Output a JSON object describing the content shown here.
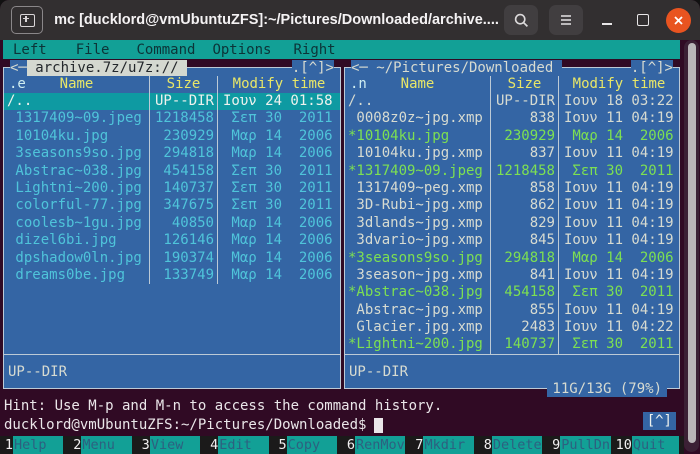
{
  "window": {
    "title": "mc [ducklord@vmUbuntuZFS]:~/Pictures/Downloaded/archive....",
    "controls": [
      "new-tab-icon",
      "search-icon",
      "hamburger-menu-icon",
      "minimize-icon",
      "maximize-icon",
      "close-icon"
    ],
    "close_color": "#e95420"
  },
  "menu": {
    "items": [
      {
        "label": "Left"
      },
      {
        "label": "File"
      },
      {
        "label": "Command"
      },
      {
        "label": "Options"
      },
      {
        "label": "Right"
      }
    ]
  },
  "left_panel": {
    "title_prefix": "<─",
    "title": " archive.7z/u7z:// ",
    "title_suffix": ".[^]>",
    "sort": ".e",
    "columns": {
      "name": "Name",
      "size": "Size",
      "modify": "Modify time"
    },
    "rows": [
      {
        "name": "/..",
        "size": "UP--DIR",
        "date": "Ιουν 24 01:58",
        "state": "selected"
      },
      {
        "name": " 1317409~09.jpeg",
        "size": "1218458",
        "date": " Σεπ 30  2011",
        "state": "regular"
      },
      {
        "name": " 10104ku.jpg",
        "size": "230929",
        "date": " Μαρ 14  2006",
        "state": "regular"
      },
      {
        "name": " 3seasons9so.jpg",
        "size": "294818",
        "date": " Μαρ 14  2006",
        "state": "regular"
      },
      {
        "name": " Abstrac~038.jpg",
        "size": "454158",
        "date": " Σεπ 30  2011",
        "state": "regular"
      },
      {
        "name": " Lightni~200.jpg",
        "size": "140737",
        "date": " Σεπ 30  2011",
        "state": "regular"
      },
      {
        "name": " colorful-77.jpg",
        "size": "347675",
        "date": " Σεπ 30  2011",
        "state": "regular"
      },
      {
        "name": " coolesb~1gu.jpg",
        "size": "40850",
        "date": " Μαρ 14  2006",
        "state": "regular"
      },
      {
        "name": " dizel6bi.jpg",
        "size": "126146",
        "date": " Μαρ 14  2006",
        "state": "regular"
      },
      {
        "name": " dpshadow0ln.jpg",
        "size": "190374",
        "date": " Μαρ 14  2006",
        "state": "regular"
      },
      {
        "name": " dreams0be.jpg",
        "size": "133749",
        "date": " Μαρ 14  2006",
        "state": "regular"
      }
    ],
    "status": "UP--DIR"
  },
  "right_panel": {
    "title_prefix": "<─",
    "title": " ~/Pictures/Downloaded ",
    "title_suffix": ".[^]>",
    "sort": ".n",
    "columns": {
      "name": "Name",
      "size": "Size",
      "modify": "Modify time"
    },
    "rows": [
      {
        "name": "/..",
        "size": "UP--DIR",
        "date": "Ιουν 18 03:22",
        "state": "plain"
      },
      {
        "name": " 0008z0z~jpg.xmp",
        "size": "838",
        "date": "Ιουν 11 04:19",
        "state": "plain"
      },
      {
        "name": "*10104ku.jpg",
        "size": "230929",
        "date": " Μαρ 14  2006",
        "state": "tagged"
      },
      {
        "name": " 10104ku.jpg.xmp",
        "size": "837",
        "date": "Ιουν 11 04:19",
        "state": "plain"
      },
      {
        "name": "*1317409~09.jpeg",
        "size": "1218458",
        "date": " Σεπ 30  2011",
        "state": "tagged"
      },
      {
        "name": " 1317409~peg.xmp",
        "size": "858",
        "date": "Ιουν 11 04:19",
        "state": "plain"
      },
      {
        "name": " 3D-Rubi~jpg.xmp",
        "size": "862",
        "date": "Ιουν 11 04:19",
        "state": "plain"
      },
      {
        "name": " 3dlands~jpg.xmp",
        "size": "829",
        "date": "Ιουν 11 04:19",
        "state": "plain"
      },
      {
        "name": " 3dvario~jpg.xmp",
        "size": "845",
        "date": "Ιουν 11 04:19",
        "state": "plain"
      },
      {
        "name": "*3seasons9so.jpg",
        "size": "294818",
        "date": " Μαρ 14  2006",
        "state": "tagged"
      },
      {
        "name": " 3season~jpg.xmp",
        "size": "841",
        "date": "Ιουν 11 04:19",
        "state": "plain"
      },
      {
        "name": "*Abstrac~038.jpg",
        "size": "454158",
        "date": " Σεπ 30  2011",
        "state": "tagged"
      },
      {
        "name": " Abstrac~jpg.xmp",
        "size": "855",
        "date": "Ιουν 11 04:19",
        "state": "plain"
      },
      {
        "name": " Glacier.jpg.xmp",
        "size": "2483",
        "date": "Ιουν 11 04:22",
        "state": "plain"
      },
      {
        "name": "*Lightni~200.jpg",
        "size": "140737",
        "date": " Σεπ 30  2011",
        "state": "tagged"
      }
    ],
    "status": "UP--DIR",
    "free_space": "11G/13G (79%)"
  },
  "hint": "Hint: Use M-p and M-n to access the command history.",
  "prompt": "ducklord@vmUbuntuZFS:~/Pictures/Downloaded$",
  "history_button": "[^]",
  "fnbar": {
    "items": [
      {
        "num": "1",
        "label": "Help"
      },
      {
        "num": "2",
        "label": "Menu"
      },
      {
        "num": "3",
        "label": "View"
      },
      {
        "num": "4",
        "label": "Edit"
      },
      {
        "num": "5",
        "label": "Copy"
      },
      {
        "num": "6",
        "label": "RenMov"
      },
      {
        "num": "7",
        "label": "Mkdir"
      },
      {
        "num": "8",
        "label": "Delete"
      },
      {
        "num": "9",
        "label": "PullDn"
      },
      {
        "num": "10",
        "label": "Quit"
      }
    ]
  },
  "colors": {
    "panel_bg": "#3465a4",
    "teal": "#12a096",
    "selected_bg": "#0e9aa2",
    "file_cyan": "#4fc4da",
    "tagged_green": "#7de052",
    "header_yellow": "#e9e767",
    "terminal_bg": "#300a24",
    "close_orange": "#e95420"
  }
}
